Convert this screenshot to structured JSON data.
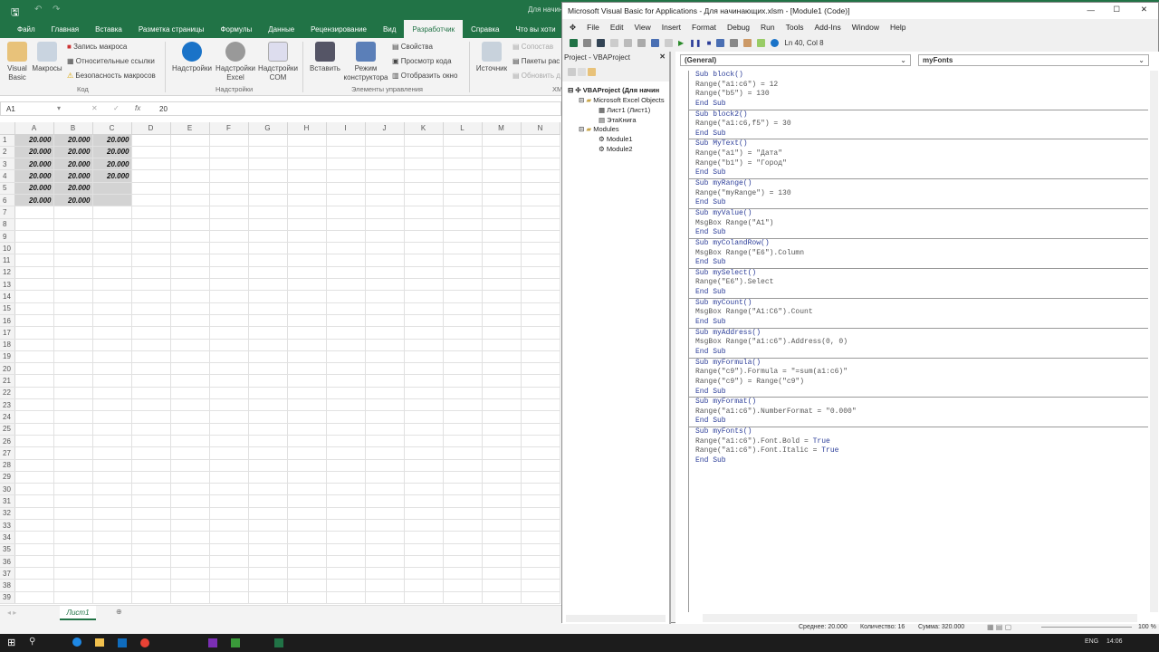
{
  "excel": {
    "title": "Для начин",
    "tabs": [
      "Файл",
      "Главная",
      "Вставка",
      "Разметка страницы",
      "Формулы",
      "Данные",
      "Рецензирование",
      "Вид",
      "Разработчик",
      "Справка",
      "Что вы хоти"
    ],
    "active_tab": "Разработчик",
    "ribbon": {
      "visual_basic": "Visual Basic",
      "macros": "Макросы",
      "record_macro": "Запись макроса",
      "relative_refs": "Относительные ссылки",
      "macro_security": "Безопасность макросов",
      "group_code": "Код",
      "addins": "Надстройки",
      "excel_addins": "Надстройки Excel",
      "com_addins": "Надстройки COM",
      "group_addins": "Надстройки",
      "insert": "Вставить",
      "design_mode": "Режим конструктора",
      "properties": "Свойства",
      "view_code": "Просмотр кода",
      "run_dialog": "Отобразить окно",
      "group_controls": "Элементы управления",
      "source": "Источник",
      "map_props": "Сопостав",
      "expansion_packs": "Пакеты рас",
      "refresh": "Обновить д",
      "group_xml": "XM"
    },
    "name_box": "A1",
    "formula": "20",
    "columns": [
      "A",
      "B",
      "C",
      "D",
      "E",
      "F",
      "G",
      "H",
      "I",
      "J",
      "K",
      "L",
      "M",
      "N"
    ],
    "rows": 39,
    "cells": [
      [
        "20.000",
        "20.000",
        "20.000"
      ],
      [
        "20.000",
        "20.000",
        "20.000"
      ],
      [
        "20.000",
        "20.000",
        "20.000"
      ],
      [
        "20.000",
        "20.000",
        "20.000"
      ],
      [
        "20.000",
        "20.000",
        ""
      ],
      [
        "20.000",
        "20.000",
        ""
      ]
    ],
    "sheet_tab": "Лист1",
    "status": {
      "average": "Среднее: 20.000",
      "count": "Количество: 16",
      "sum": "Сумма: 320.000",
      "zoom": "100 %"
    }
  },
  "vbe": {
    "title": "Microsoft Visual Basic for Applications - Для начинающих.xlsm - [Module1 (Code)]",
    "menu": [
      "File",
      "Edit",
      "View",
      "Insert",
      "Format",
      "Debug",
      "Run",
      "Tools",
      "Add-Ins",
      "Window",
      "Help"
    ],
    "cursor_pos": "Ln 40, Col 8",
    "project_title": "Project - VBAProject",
    "tree": {
      "root": "VBAProject (Для начин",
      "excel_objects": "Microsoft Excel Objects",
      "sheet1": "Лист1 (Лист1)",
      "workbook": "ЭтаКнига",
      "modules": "Modules",
      "module1": "Module1",
      "module2": "Module2"
    },
    "object_dd": "(General)",
    "proc_dd": "myFonts",
    "procedures": [
      [
        "Sub block()",
        "Range(\"a1:c6\") = 12",
        "Range(\"b5\") = 130",
        "End Sub"
      ],
      [
        "Sub block2()",
        "Range(\"a1:c6,f5\") = 30",
        "End Sub"
      ],
      [
        "Sub MyText()",
        "Range(\"a1\") = \"Дата\"",
        "Range(\"b1\") = \"Город\"",
        "End Sub"
      ],
      [
        "Sub myRange()",
        "Range(\"myRange\") = 130",
        "End Sub"
      ],
      [
        "Sub myValue()",
        "MsgBox Range(\"A1\")",
        "End Sub"
      ],
      [
        "Sub myColandRow()",
        "MsgBox Range(\"E6\").Column",
        "End Sub"
      ],
      [
        "Sub mySelect()",
        "Range(\"E6\").Select",
        "End Sub"
      ],
      [
        "Sub myCount()",
        "MsgBox Range(\"A1:C6\").Count",
        "End Sub"
      ],
      [
        "Sub myAddress()",
        "MsgBox Range(\"a1:c6\").Address(0, 0)",
        "End Sub"
      ],
      [
        "Sub myFormula()",
        "Range(\"c9\").Formula = \"=sum(a1:c6)\"",
        "Range(\"c9\") = Range(\"c9\")",
        "End Sub"
      ],
      [
        "Sub myFormat()",
        "Range(\"a1:c6\").NumberFormat = \"0.000\"",
        "End Sub"
      ],
      [
        "Sub myFonts()",
        "Range(\"a1:c6\").Font.Bold = True",
        "Range(\"a1:c6\").Font.Italic = True",
        "End Sub"
      ]
    ]
  },
  "taskbar": {
    "lang": "ENG",
    "time": "14:06"
  },
  "colors": {
    "excel_green": "#217346",
    "keyword": "#2b3d99"
  }
}
